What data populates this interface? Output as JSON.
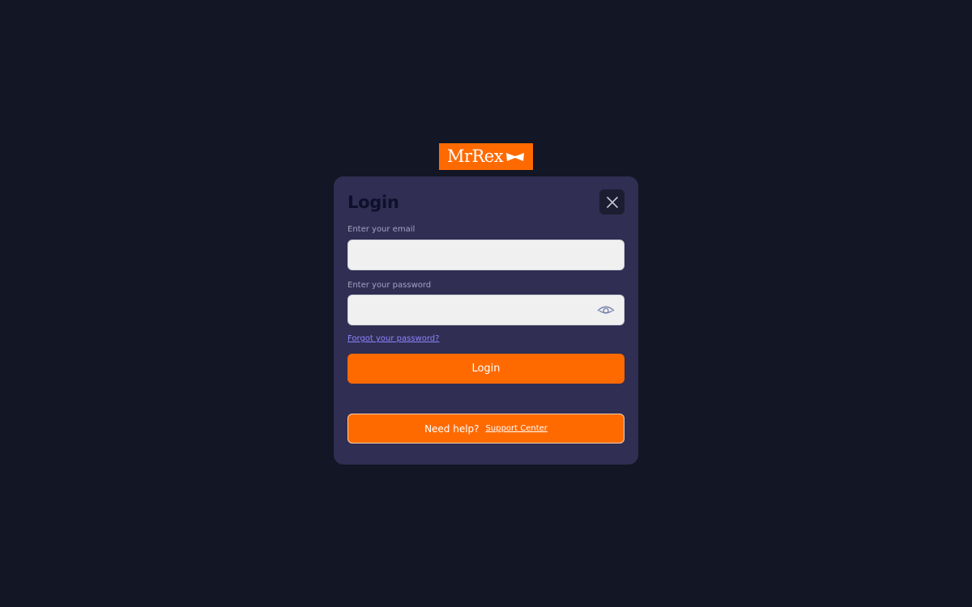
{
  "brand": {
    "logo_text": "MrRex",
    "accent_color": "#ff6a00",
    "logo_icon": "bowtie-icon"
  },
  "colors": {
    "page_background": "#131624",
    "modal_background": "#302e53",
    "input_background": "#f0f0f0",
    "link_color": "#8a86ff"
  },
  "modal": {
    "title": "Login",
    "close_icon": "close-icon"
  },
  "form": {
    "email_label": "Enter your email",
    "email_value": "",
    "email_placeholder": "",
    "password_label": "Enter your password",
    "password_value": "",
    "password_placeholder": "",
    "password_toggle_icon": "eye-icon",
    "forgot_link": "Forgot your password?",
    "login_button": "Login"
  },
  "help": {
    "text": "Need help?",
    "link": "Support Center"
  }
}
